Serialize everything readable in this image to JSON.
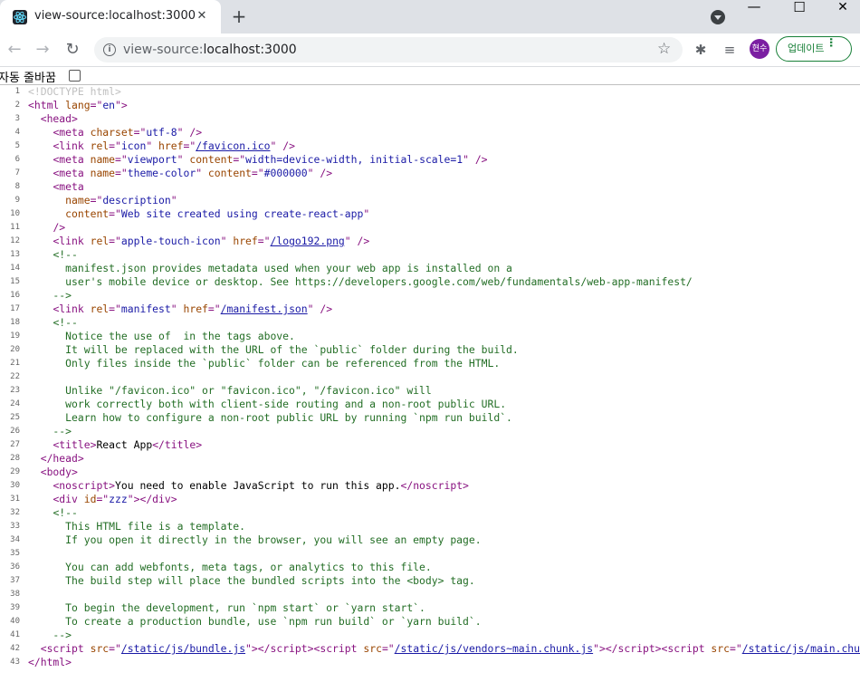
{
  "tab": {
    "title": "view-source:localhost:3000",
    "close_label": "✕",
    "new_tab_label": "+"
  },
  "window": {
    "minimize": "—",
    "maximize": "☐",
    "close": "✕"
  },
  "toolbar": {
    "url_scheme": "view-source:",
    "url_host": "localhost:3000",
    "avatar_text": "현수",
    "update_label": "업데이트"
  },
  "wrap": {
    "label": "자동 줄바꿈"
  },
  "icons": [
    "react-favicon-icon",
    "back-icon",
    "forward-icon",
    "reload-icon",
    "info-icon",
    "star-icon",
    "extensions-icon",
    "media-icon",
    "more-icon"
  ],
  "colors": {
    "tag": "#881280",
    "attr": "#994500",
    "value": "#1a1aa6",
    "comment": "#236e25",
    "doctype": "#c0c0c0",
    "update_green": "#188038",
    "avatar": "#7b1fa2"
  },
  "source_lines": [
    {
      "n": "1",
      "html": "<span class='d'>&lt;!DOCTYPE html&gt;</span>"
    },
    {
      "n": "2",
      "html": "<span class='t'>&lt;html </span><span class='a'>lang</span><span class='t'>=\"</span><span class='v'>en</span><span class='t'>\"&gt;</span>"
    },
    {
      "n": "3",
      "html": "  <span class='t'>&lt;head&gt;</span>"
    },
    {
      "n": "4",
      "html": "    <span class='t'>&lt;meta </span><span class='a'>charset</span><span class='t'>=\"</span><span class='v'>utf-8</span><span class='t'>\" /&gt;</span>"
    },
    {
      "n": "5",
      "html": "    <span class='t'>&lt;link </span><span class='a'>rel</span><span class='t'>=\"</span><span class='v'>icon</span><span class='t'>\" </span><span class='a'>href</span><span class='t'>=\"</span><span class='lk'>/favicon.ico</span><span class='t'>\" /&gt;</span>"
    },
    {
      "n": "6",
      "html": "    <span class='t'>&lt;meta </span><span class='a'>name</span><span class='t'>=\"</span><span class='v'>viewport</span><span class='t'>\" </span><span class='a'>content</span><span class='t'>=\"</span><span class='v'>width=device-width, initial-scale=1</span><span class='t'>\" /&gt;</span>"
    },
    {
      "n": "7",
      "html": "    <span class='t'>&lt;meta </span><span class='a'>name</span><span class='t'>=\"</span><span class='v'>theme-color</span><span class='t'>\" </span><span class='a'>content</span><span class='t'>=\"</span><span class='v'>#000000</span><span class='t'>\" /&gt;</span>"
    },
    {
      "n": "8",
      "html": "    <span class='t'>&lt;meta</span>"
    },
    {
      "n": "9",
      "html": "      <span class='a'>name</span><span class='t'>=\"</span><span class='v'>description</span><span class='t'>\"</span>"
    },
    {
      "n": "10",
      "html": "      <span class='a'>content</span><span class='t'>=\"</span><span class='v'>Web site created using create-react-app</span><span class='t'>\"</span>"
    },
    {
      "n": "11",
      "html": "    <span class='t'>/&gt;</span>"
    },
    {
      "n": "12",
      "html": "    <span class='t'>&lt;link </span><span class='a'>rel</span><span class='t'>=\"</span><span class='v'>apple-touch-icon</span><span class='t'>\" </span><span class='a'>href</span><span class='t'>=\"</span><span class='lk'>/logo192.png</span><span class='t'>\" /&gt;</span>"
    },
    {
      "n": "13",
      "html": "    <span class='c'>&lt;!--</span>"
    },
    {
      "n": "14",
      "html": "<span class='c'>      manifest.json provides metadata used when your web app is installed on a</span>"
    },
    {
      "n": "15",
      "html": "<span class='c'>      user's mobile device or desktop. See https://developers.google.com/web/fundamentals/web-app-manifest/</span>"
    },
    {
      "n": "16",
      "html": "<span class='c'>    --&gt;</span>"
    },
    {
      "n": "17",
      "html": "    <span class='t'>&lt;link </span><span class='a'>rel</span><span class='t'>=\"</span><span class='v'>manifest</span><span class='t'>\" </span><span class='a'>href</span><span class='t'>=\"</span><span class='lk'>/manifest.json</span><span class='t'>\" /&gt;</span>"
    },
    {
      "n": "18",
      "html": "    <span class='c'>&lt;!--</span>"
    },
    {
      "n": "19",
      "html": "<span class='c'>      Notice the use of  in the tags above.</span>"
    },
    {
      "n": "20",
      "html": "<span class='c'>      It will be replaced with the URL of the `public` folder during the build.</span>"
    },
    {
      "n": "21",
      "html": "<span class='c'>      Only files inside the `public` folder can be referenced from the HTML.</span>"
    },
    {
      "n": "22",
      "html": ""
    },
    {
      "n": "23",
      "html": "<span class='c'>      Unlike \"/favicon.ico\" or \"favicon.ico\", \"/favicon.ico\" will</span>"
    },
    {
      "n": "24",
      "html": "<span class='c'>      work correctly both with client-side routing and a non-root public URL.</span>"
    },
    {
      "n": "25",
      "html": "<span class='c'>      Learn how to configure a non-root public URL by running `npm run build`.</span>"
    },
    {
      "n": "26",
      "html": "<span class='c'>    --&gt;</span>"
    },
    {
      "n": "27",
      "html": "    <span class='t'>&lt;title&gt;</span>React App<span class='t'>&lt;/title&gt;</span>"
    },
    {
      "n": "28",
      "html": "  <span class='t'>&lt;/head&gt;</span>"
    },
    {
      "n": "29",
      "html": "  <span class='t'>&lt;body&gt;</span>"
    },
    {
      "n": "30",
      "html": "    <span class='t'>&lt;noscript&gt;</span>You need to enable JavaScript to run this app.<span class='t'>&lt;/noscript&gt;</span>"
    },
    {
      "n": "31",
      "html": "    <span class='t'>&lt;div </span><span class='a'>id</span><span class='t'>=\"</span><span class='v'>zzz</span><span class='t'>\"&gt;&lt;/div&gt;</span>"
    },
    {
      "n": "32",
      "html": "    <span class='c'>&lt;!--</span>"
    },
    {
      "n": "33",
      "html": "<span class='c'>      This HTML file is a template.</span>"
    },
    {
      "n": "34",
      "html": "<span class='c'>      If you open it directly in the browser, you will see an empty page.</span>"
    },
    {
      "n": "35",
      "html": ""
    },
    {
      "n": "36",
      "html": "<span class='c'>      You can add webfonts, meta tags, or analytics to this file.</span>"
    },
    {
      "n": "37",
      "html": "<span class='c'>      The build step will place the bundled scripts into the &lt;body&gt; tag.</span>"
    },
    {
      "n": "38",
      "html": ""
    },
    {
      "n": "39",
      "html": "<span class='c'>      To begin the development, run `npm start` or `yarn start`.</span>"
    },
    {
      "n": "40",
      "html": "<span class='c'>      To create a production bundle, use `npm run build` or `yarn build`.</span>"
    },
    {
      "n": "41",
      "html": "<span class='c'>    --&gt;</span>"
    },
    {
      "n": "42",
      "html": "  <span class='t'>&lt;script </span><span class='a'>src</span><span class='t'>=\"</span><span class='lk'>/static/js/bundle.js</span><span class='t'>\"&gt;&lt;/script&gt;&lt;script </span><span class='a'>src</span><span class='t'>=\"</span><span class='lk'>/static/js/vendors~main.chunk.js</span><span class='t'>\"&gt;&lt;/script&gt;&lt;script </span><span class='a'>src</span><span class='t'>=\"</span><span class='lk'>/static/js/main.chunk.js</span><span class='t'>\"&gt;&lt;/script&gt;</span>"
    },
    {
      "n": "43",
      "html": "<span class='t'>&lt;/html&gt;</span>"
    }
  ]
}
